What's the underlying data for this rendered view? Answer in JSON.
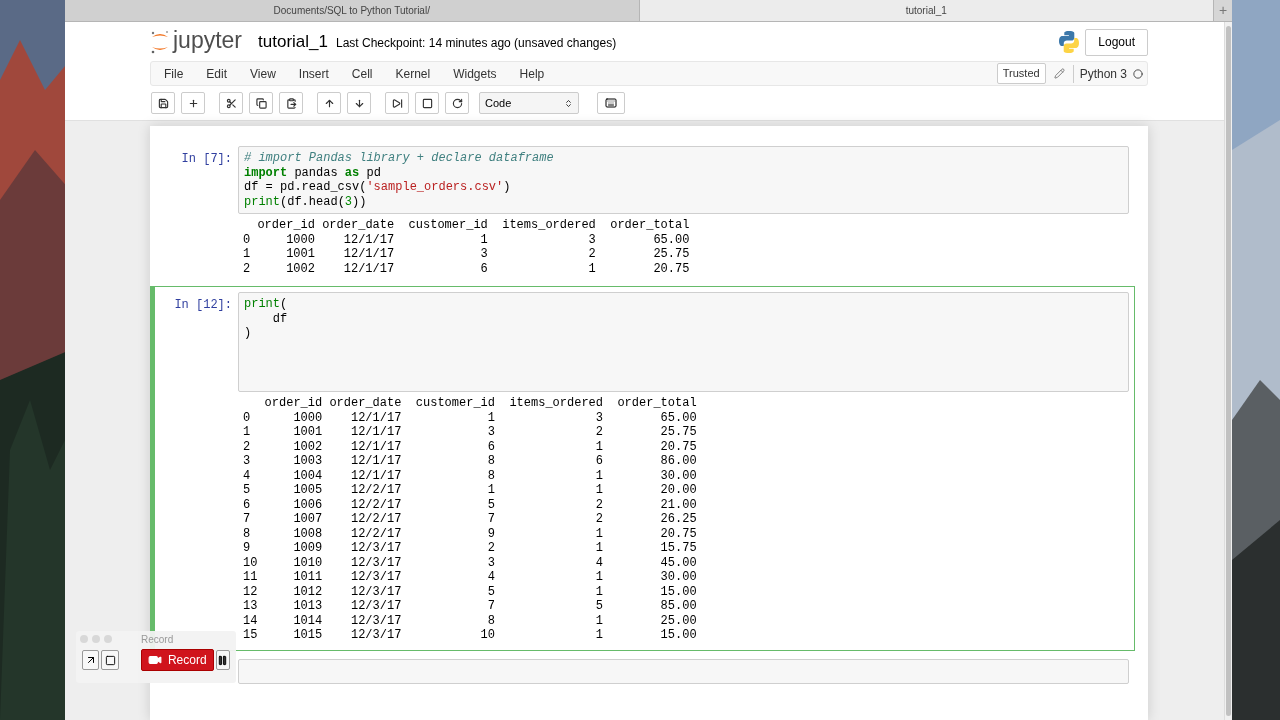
{
  "browser": {
    "tabs": [
      {
        "label": "Documents/SQL to Python Tutorial/",
        "selected": false
      },
      {
        "label": "tutorial_1",
        "selected": true
      }
    ],
    "new_tab": "+"
  },
  "header": {
    "logo": "jupyter",
    "notebook_name": "tutorial_1",
    "checkpoint": "Last Checkpoint: 14 minutes ago (unsaved changes)",
    "logout": "Logout"
  },
  "menu": [
    "File",
    "Edit",
    "View",
    "Insert",
    "Cell",
    "Kernel",
    "Widgets",
    "Help"
  ],
  "kernel": {
    "trusted": "Trusted",
    "name": "Python 3",
    "busy": false
  },
  "toolbar": {
    "cell_type": "Code"
  },
  "cells": [
    {
      "prompt": "In [7]:",
      "selected": false,
      "code": [
        [
          {
            "kind": "comment",
            "text": "# import Pandas library + declare dataframe"
          }
        ],
        [
          {
            "kind": "keyword",
            "text": "import"
          },
          {
            "kind": "plain",
            "text": " pandas "
          },
          {
            "kind": "keyword",
            "text": "as"
          },
          {
            "kind": "plain",
            "text": " pd"
          }
        ],
        [
          {
            "kind": "plain",
            "text": "df = pd.read_csv("
          },
          {
            "kind": "string",
            "text": "'sample_orders.csv'"
          },
          {
            "kind": "plain",
            "text": ")"
          }
        ],
        [
          {
            "kind": "builtin",
            "text": "print"
          },
          {
            "kind": "plain",
            "text": "(df.head("
          },
          {
            "kind": "number",
            "text": "3"
          },
          {
            "kind": "plain",
            "text": "))"
          }
        ]
      ],
      "output": {
        "columns": [
          "",
          "order_id",
          "order_date",
          "customer_id",
          "items_ordered",
          "order_total"
        ],
        "rows": [
          [
            "0",
            "1000",
            "12/1/17",
            "1",
            "3",
            "65.00"
          ],
          [
            "1",
            "1001",
            "12/1/17",
            "3",
            "2",
            "25.75"
          ],
          [
            "2",
            "1002",
            "12/1/17",
            "6",
            "1",
            "20.75"
          ]
        ]
      }
    },
    {
      "prompt": "In [12]:",
      "selected": true,
      "code": [
        [
          {
            "kind": "builtin",
            "text": "print"
          },
          {
            "kind": "plain",
            "text": "("
          }
        ],
        [
          {
            "kind": "plain",
            "text": "    df"
          }
        ],
        [
          {
            "kind": "plain",
            "text": ")"
          }
        ]
      ],
      "output": {
        "columns": [
          "",
          "order_id",
          "order_date",
          "customer_id",
          "items_ordered",
          "order_total"
        ],
        "rows": [
          [
            "0",
            "1000",
            "12/1/17",
            "1",
            "3",
            "65.00"
          ],
          [
            "1",
            "1001",
            "12/1/17",
            "3",
            "2",
            "25.75"
          ],
          [
            "2",
            "1002",
            "12/1/17",
            "6",
            "1",
            "20.75"
          ],
          [
            "3",
            "1003",
            "12/1/17",
            "8",
            "6",
            "86.00"
          ],
          [
            "4",
            "1004",
            "12/1/17",
            "8",
            "1",
            "30.00"
          ],
          [
            "5",
            "1005",
            "12/2/17",
            "1",
            "1",
            "20.00"
          ],
          [
            "6",
            "1006",
            "12/2/17",
            "5",
            "2",
            "21.00"
          ],
          [
            "7",
            "1007",
            "12/2/17",
            "7",
            "2",
            "26.25"
          ],
          [
            "8",
            "1008",
            "12/2/17",
            "9",
            "1",
            "20.75"
          ],
          [
            "9",
            "1009",
            "12/3/17",
            "2",
            "1",
            "15.75"
          ],
          [
            "10",
            "1010",
            "12/3/17",
            "3",
            "4",
            "45.00"
          ],
          [
            "11",
            "1011",
            "12/3/17",
            "4",
            "1",
            "30.00"
          ],
          [
            "12",
            "1012",
            "12/3/17",
            "5",
            "1",
            "15.00"
          ],
          [
            "13",
            "1013",
            "12/3/17",
            "7",
            "5",
            "85.00"
          ],
          [
            "14",
            "1014",
            "12/3/17",
            "8",
            "1",
            "25.00"
          ],
          [
            "15",
            "1015",
            "12/3/17",
            "10",
            "1",
            "15.00"
          ]
        ]
      }
    },
    {
      "selected": false
    }
  ],
  "recorder": {
    "title": "Record",
    "button": "Record"
  }
}
